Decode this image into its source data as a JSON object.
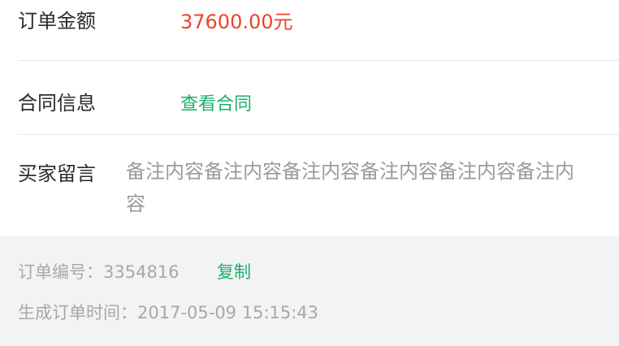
{
  "order": {
    "amount_label": "订单金额",
    "amount_value": "37600.00元",
    "contract_label": "合同信息",
    "contract_link": "查看合同",
    "message_label": "买家留言",
    "message_text": "备注内容备注内容备注内容备注内容备注内容备注内容",
    "order_number_label": "订单编号：",
    "order_number_value": "3354816",
    "copy_label": "复制",
    "created_time_label": "生成订单时间：",
    "created_time_value": "2017-05-09 15:15:43"
  },
  "colors": {
    "amount": "#f0402d",
    "link": "#1ab06b",
    "footer_background": "#f3f3f3",
    "muted_text": "#9a9a9a"
  }
}
